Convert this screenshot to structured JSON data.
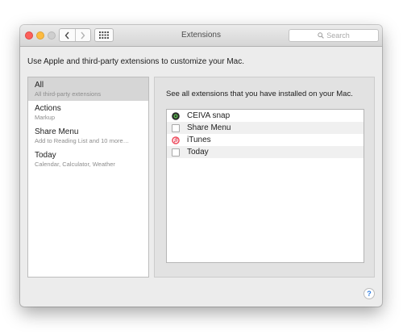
{
  "window": {
    "title": "Extensions",
    "search_placeholder": "Search"
  },
  "intro": "Use Apple and third-party extensions to customize your Mac.",
  "sidebar": {
    "items": [
      {
        "label": "All",
        "sublabel": "All third-party extensions",
        "selected": true
      },
      {
        "label": "Actions",
        "sublabel": "Markup",
        "selected": false
      },
      {
        "label": "Share Menu",
        "sublabel": "Add to Reading List and 10 more…",
        "selected": false
      },
      {
        "label": "Today",
        "sublabel": "Calendar, Calculator, Weather",
        "selected": false
      }
    ]
  },
  "panel": {
    "heading": "See all extensions that you have installed on your Mac.",
    "rows": [
      {
        "label": "CEIVA snap",
        "icon": "ceiva-app-icon"
      },
      {
        "label": "Share Menu",
        "icon": "checkbox",
        "checked": false
      },
      {
        "label": "iTunes",
        "icon": "itunes-app-icon"
      },
      {
        "label": "Today",
        "icon": "checkbox",
        "checked": false
      }
    ]
  },
  "help_label": "?",
  "colors": {
    "close": "#fc605b",
    "minimize": "#fdbb40",
    "zoom": "#cfcfcf",
    "selection": "#d6d6d6",
    "help_accent": "#2f7de1"
  }
}
